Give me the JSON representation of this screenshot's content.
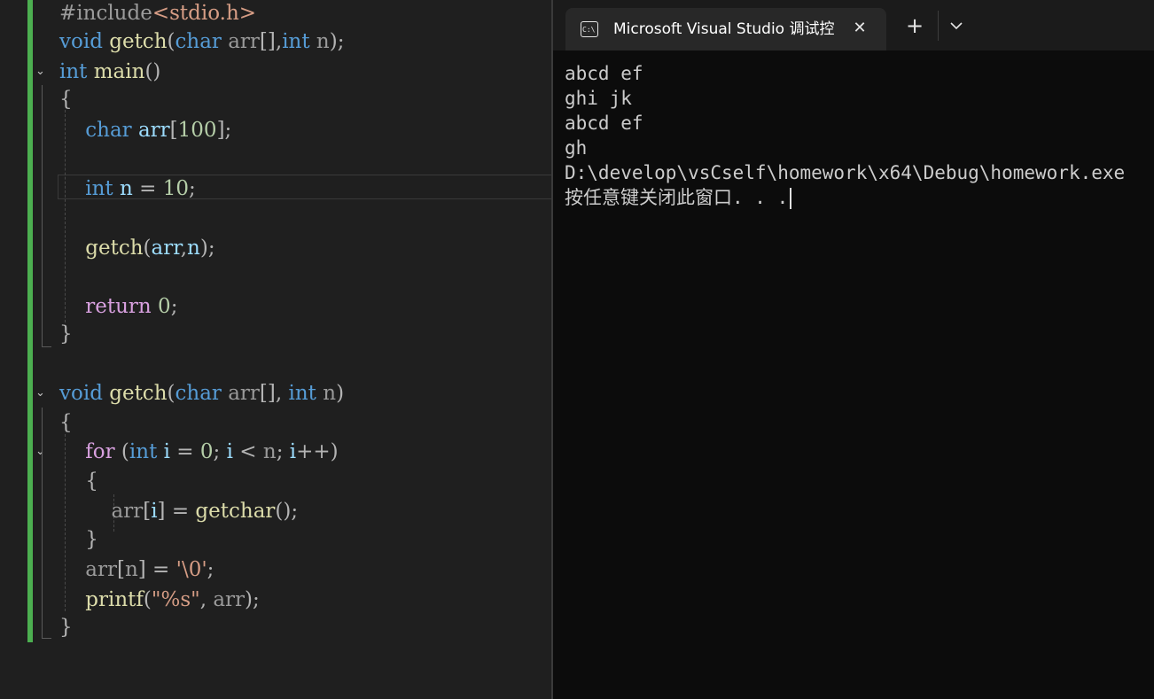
{
  "editor": {
    "lines": [
      [
        {
          "t": "#include",
          "c": "pp"
        },
        {
          "t": "<stdio.h>",
          "c": "str"
        }
      ],
      [
        {
          "t": "void",
          "c": "kw"
        },
        {
          "t": " ",
          "c": ""
        },
        {
          "t": "getch",
          "c": "fn"
        },
        {
          "t": "(",
          "c": "pun"
        },
        {
          "t": "char",
          "c": "kw"
        },
        {
          "t": " ",
          "c": ""
        },
        {
          "t": "arr",
          "c": "prm"
        },
        {
          "t": "[],",
          "c": "pun"
        },
        {
          "t": "int",
          "c": "kw"
        },
        {
          "t": " ",
          "c": ""
        },
        {
          "t": "n",
          "c": "prm"
        },
        {
          "t": ");",
          "c": "pun"
        }
      ],
      [
        {
          "t": "int",
          "c": "kw"
        },
        {
          "t": " ",
          "c": ""
        },
        {
          "t": "main",
          "c": "fn"
        },
        {
          "t": "()",
          "c": "pun"
        }
      ],
      [
        {
          "t": "{",
          "c": "pun"
        }
      ],
      [
        {
          "t": "    ",
          "c": ""
        },
        {
          "t": "char",
          "c": "kw"
        },
        {
          "t": " ",
          "c": ""
        },
        {
          "t": "arr",
          "c": "var"
        },
        {
          "t": "[",
          "c": "pun"
        },
        {
          "t": "100",
          "c": "num"
        },
        {
          "t": "];",
          "c": "pun"
        }
      ],
      [],
      [
        {
          "t": "    ",
          "c": ""
        },
        {
          "t": "int",
          "c": "kw"
        },
        {
          "t": " ",
          "c": ""
        },
        {
          "t": "n",
          "c": "var"
        },
        {
          "t": " = ",
          "c": "pun"
        },
        {
          "t": "10",
          "c": "num"
        },
        {
          "t": ";",
          "c": "pun"
        }
      ],
      [],
      [
        {
          "t": "    ",
          "c": ""
        },
        {
          "t": "getch",
          "c": "fn"
        },
        {
          "t": "(",
          "c": "pun"
        },
        {
          "t": "arr",
          "c": "var"
        },
        {
          "t": ",",
          "c": "pun"
        },
        {
          "t": "n",
          "c": "var"
        },
        {
          "t": ");",
          "c": "pun"
        }
      ],
      [],
      [
        {
          "t": "    ",
          "c": ""
        },
        {
          "t": "return",
          "c": "ctl"
        },
        {
          "t": " ",
          "c": ""
        },
        {
          "t": "0",
          "c": "num"
        },
        {
          "t": ";",
          "c": "pun"
        }
      ],
      [
        {
          "t": "}",
          "c": "pun"
        }
      ],
      [],
      [
        {
          "t": "void",
          "c": "kw"
        },
        {
          "t": " ",
          "c": ""
        },
        {
          "t": "getch",
          "c": "fn"
        },
        {
          "t": "(",
          "c": "pun"
        },
        {
          "t": "char",
          "c": "kw"
        },
        {
          "t": " ",
          "c": ""
        },
        {
          "t": "arr",
          "c": "prm"
        },
        {
          "t": "[], ",
          "c": "pun"
        },
        {
          "t": "int",
          "c": "kw"
        },
        {
          "t": " ",
          "c": ""
        },
        {
          "t": "n",
          "c": "prm"
        },
        {
          "t": ")",
          "c": "pun"
        }
      ],
      [
        {
          "t": "{",
          "c": "pun"
        }
      ],
      [
        {
          "t": "    ",
          "c": ""
        },
        {
          "t": "for",
          "c": "ctl"
        },
        {
          "t": " (",
          "c": "pun"
        },
        {
          "t": "int",
          "c": "kw"
        },
        {
          "t": " ",
          "c": ""
        },
        {
          "t": "i",
          "c": "var"
        },
        {
          "t": " = ",
          "c": "pun"
        },
        {
          "t": "0",
          "c": "num"
        },
        {
          "t": "; ",
          "c": "pun"
        },
        {
          "t": "i",
          "c": "var"
        },
        {
          "t": " < ",
          "c": "pun"
        },
        {
          "t": "n",
          "c": "prm"
        },
        {
          "t": "; ",
          "c": "pun"
        },
        {
          "t": "i",
          "c": "var"
        },
        {
          "t": "++)",
          "c": "pun"
        }
      ],
      [
        {
          "t": "    {",
          "c": "pun"
        }
      ],
      [
        {
          "t": "        ",
          "c": ""
        },
        {
          "t": "arr",
          "c": "prm"
        },
        {
          "t": "[",
          "c": "pun"
        },
        {
          "t": "i",
          "c": "var"
        },
        {
          "t": "] = ",
          "c": "pun"
        },
        {
          "t": "getchar",
          "c": "fn"
        },
        {
          "t": "();",
          "c": "pun"
        }
      ],
      [
        {
          "t": "    }",
          "c": "pun"
        }
      ],
      [
        {
          "t": "    ",
          "c": ""
        },
        {
          "t": "arr",
          "c": "prm"
        },
        {
          "t": "[",
          "c": "pun"
        },
        {
          "t": "n",
          "c": "prm"
        },
        {
          "t": "] = ",
          "c": "pun"
        },
        {
          "t": "'\\0'",
          "c": "str"
        },
        {
          "t": ";",
          "c": "pun"
        }
      ],
      [
        {
          "t": "    ",
          "c": ""
        },
        {
          "t": "printf",
          "c": "fn"
        },
        {
          "t": "(",
          "c": "pun"
        },
        {
          "t": "\"%s\"",
          "c": "str"
        },
        {
          "t": ", ",
          "c": "pun"
        },
        {
          "t": "arr",
          "c": "prm"
        },
        {
          "t": ");",
          "c": "pun"
        }
      ],
      [
        {
          "t": "}",
          "c": "pun"
        }
      ]
    ]
  },
  "terminal": {
    "tab_title": "Microsoft Visual Studio 调试控",
    "tab_icon": "console-icon",
    "close_icon": "close-icon",
    "new_tab_icon": "plus-icon",
    "dropdown_icon": "chevron-down-icon",
    "output": [
      "abcd ef",
      "ghi jk",
      "abcd ef",
      "gh",
      "D:\\develop\\vsCself\\homework\\x64\\Debug\\homework.exe",
      "按任意键关闭此窗口. . ."
    ]
  }
}
